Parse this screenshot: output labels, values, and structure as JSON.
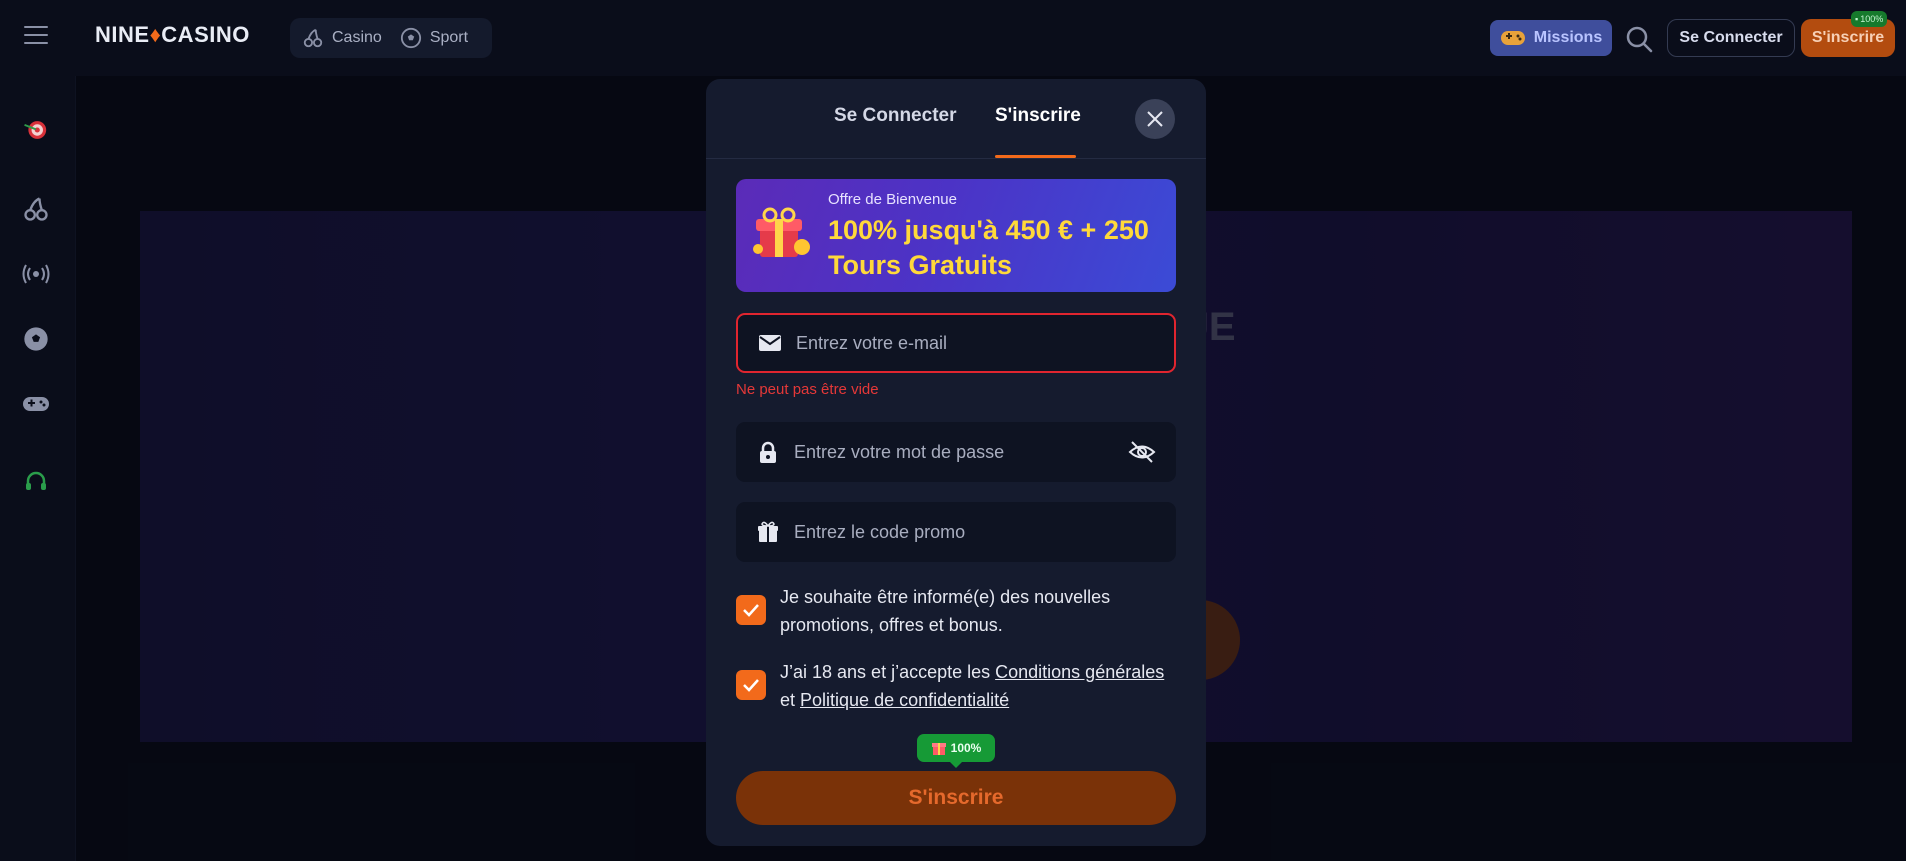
{
  "header": {
    "logo": {
      "part1": "NINE",
      "part2": "CASINO"
    },
    "nav": [
      {
        "label": "Casino",
        "icon": "cherry-icon"
      },
      {
        "label": "Sport",
        "icon": "soccer-ball-icon"
      }
    ],
    "missions_label": "Missions",
    "login_label": "Se Connecter",
    "signup_label": "S'inscrire",
    "signup_badge": "100%"
  },
  "sidebar": {
    "items": [
      {
        "icon": "target-dart-icon"
      },
      {
        "icon": "cherry-icon"
      },
      {
        "icon": "live-broadcast-icon"
      },
      {
        "icon": "soccer-ball-icon"
      },
      {
        "icon": "gamepad-icon"
      },
      {
        "icon": "support-headset-icon"
      }
    ]
  },
  "hero": {
    "partial_text": "UE"
  },
  "modal": {
    "tabs": {
      "login": "Se Connecter",
      "signup": "S'inscrire",
      "active": "signup"
    },
    "promo": {
      "title": "Offre de Bienvenue",
      "offer": "100% jusqu'à 450 € + 250 Tours Gratuits"
    },
    "email": {
      "placeholder": "Entrez votre e-mail",
      "value": "",
      "error": "Ne peut pas être vide"
    },
    "password": {
      "placeholder": "Entrez votre mot de passe",
      "value": ""
    },
    "promo_code": {
      "placeholder": "Entrez le code promo",
      "value": ""
    },
    "consents": {
      "newsletter": {
        "text": "Je souhaite être informé(e) des nouvelles promotions, offres et bonus.",
        "checked": true
      },
      "terms": {
        "prefix": "J’ai 18 ans et j’accepte les ",
        "terms_link": "Conditions générales",
        "middle": " et ",
        "privacy_link": "Politique de confidentialité",
        "checked": true
      }
    },
    "bonus_tag": "100%",
    "submit_label": "S'inscrire"
  },
  "colors": {
    "accent": "#f26a1b",
    "error": "#e0252f",
    "promo_text": "#ffd93a",
    "badge_green": "#169a36"
  }
}
